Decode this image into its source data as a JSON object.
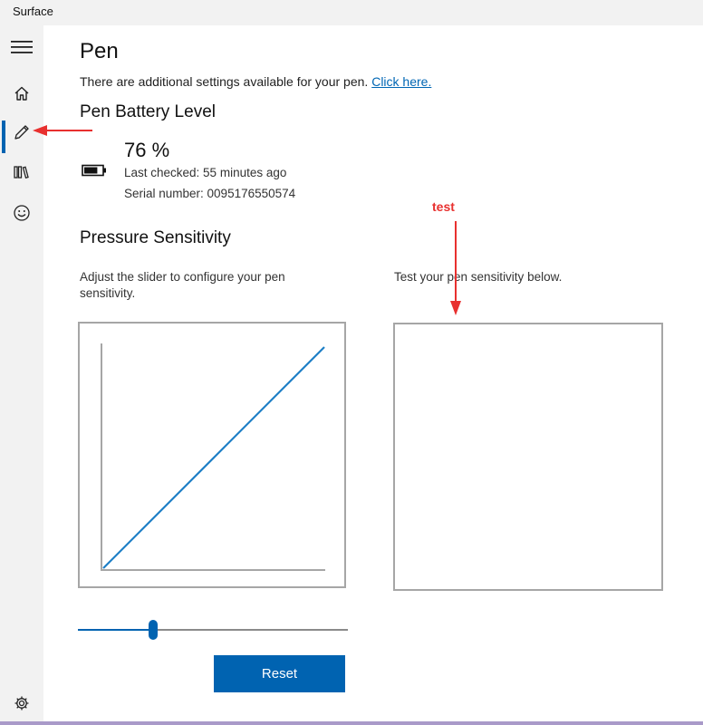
{
  "app": {
    "title": "Surface"
  },
  "sidebar": {
    "items": [
      {
        "name": "menu",
        "icon": "hamburger-menu-icon"
      },
      {
        "name": "home",
        "icon": "home-icon"
      },
      {
        "name": "pen",
        "icon": "pen-icon",
        "active": true
      },
      {
        "name": "library",
        "icon": "library-icon"
      },
      {
        "name": "feedback",
        "icon": "smiley-icon"
      },
      {
        "name": "settings",
        "icon": "gear-icon"
      }
    ]
  },
  "page": {
    "title": "Pen",
    "intro_text": "There are additional settings available for your pen.",
    "intro_link": "Click here."
  },
  "battery": {
    "heading": "Pen Battery Level",
    "percent": "76 %",
    "level": 0.76,
    "last_checked": "Last checked:  55 minutes ago",
    "serial": "Serial number:  0095176550574",
    "icon": "battery-icon"
  },
  "pressure": {
    "heading": "Pressure Sensitivity",
    "description": "Adjust the slider to configure your pen sensitivity.",
    "test_description": "Test your pen sensitivity below.",
    "slider_value": 0.28,
    "reset_label": "Reset"
  },
  "annotations": {
    "test_label": "test",
    "color": "#e8302f"
  },
  "colors": {
    "accent": "#0063b1",
    "link": "#0066b4",
    "curve": "#1e7fc6"
  }
}
